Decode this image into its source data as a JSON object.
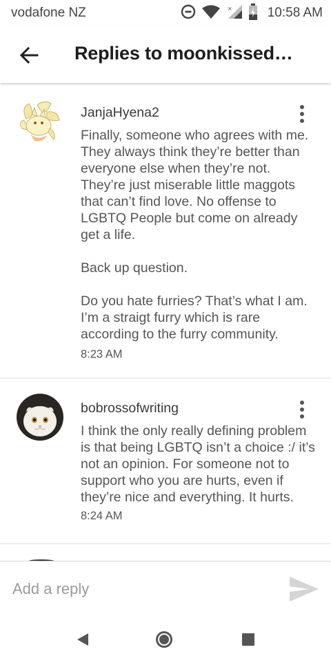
{
  "status_bar": {
    "carrier": "vodafone NZ",
    "time": "10:58 AM",
    "icons": [
      "do-not-disturb-icon",
      "wifi-icon",
      "signal-icon",
      "battery-charging-icon"
    ]
  },
  "header": {
    "back_icon": "back-arrow-icon",
    "title": "Replies to moonkissed…"
  },
  "comments": [
    {
      "username": "JanjaHyena2",
      "avatar": "ninetales-avatar",
      "body": "Finally, someone who agrees with me. They always think they’re better than everyone else when they’re not. They’re just miserable little maggots that can’t find love. No offense to LGBTQ People but come on already get a life.\n\nBack up question.\n\nDo you hate furries? That’s what I am. I’m a straigt furry which is rare according to the furry community.",
      "time": "8:23 AM",
      "more_icon": "more-vert-icon"
    },
    {
      "username": "bobrossofwriting",
      "avatar": "white-cat-avatar",
      "body": "I think the only really defining problem is that being LGBTQ isn’t a choice :/ it’s not an opinion. For someone not to support who you are hurts, even if they’re nice and everything. It hurts.",
      "time": "8:24 AM",
      "more_icon": "more-vert-icon"
    }
  ],
  "reply_bar": {
    "placeholder": "Add a reply",
    "send_icon": "send-icon"
  },
  "nav_bar": {
    "icons": [
      "nav-back-icon",
      "nav-home-icon",
      "nav-recents-icon"
    ]
  },
  "colors": {
    "text_primary": "#222222",
    "text_secondary": "#555555",
    "divider": "#dcdcdc",
    "icon_gray": "#555555"
  }
}
